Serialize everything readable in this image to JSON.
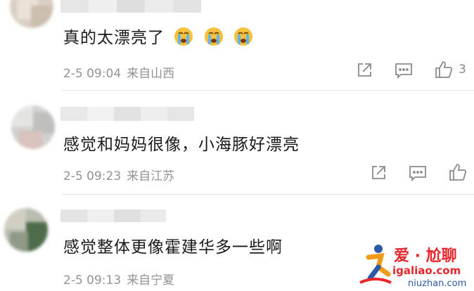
{
  "comments": [
    {
      "text": "真的太漂亮了",
      "emojis": [
        "crying-emoji",
        "crying-emoji",
        "crying-emoji"
      ],
      "date": "2-5 09:04",
      "location": "来自山西",
      "likes": "3"
    },
    {
      "text": "感觉和妈妈很像，小海豚好漂亮",
      "date": "2-5 09:23",
      "location": "来自江苏",
      "likes": ""
    },
    {
      "text": "感觉整体更像霍建华多一些啊",
      "date": "2-5 09:13",
      "location": "来自宁夏",
      "likes": ""
    }
  ],
  "watermark": {
    "brand": "爱 · 尬聊",
    "url_main": "igaliao.com",
    "url_secondary": "niuzhan.com"
  },
  "icons": {
    "share": "share-icon",
    "comment": "comment-icon",
    "like": "thumbs-up-icon"
  },
  "colors": {
    "text": "#1a1a1a",
    "meta": "#939393",
    "watermark_red": "#e8262c",
    "watermark_blue": "#2b5aa8"
  }
}
